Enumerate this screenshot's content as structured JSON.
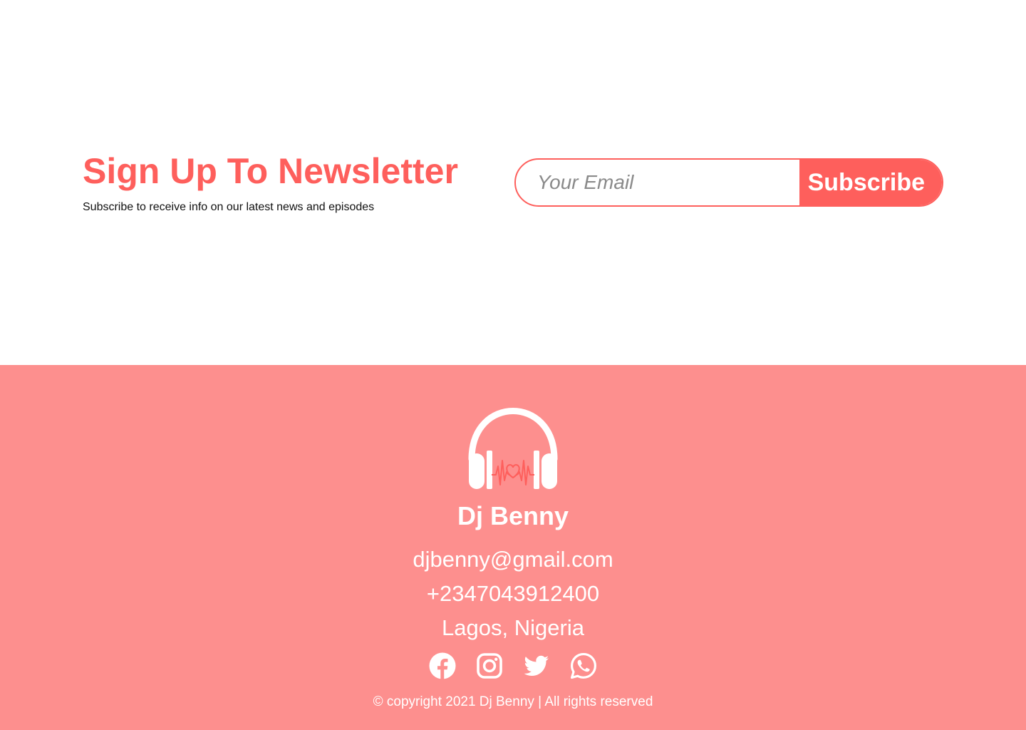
{
  "newsletter": {
    "title": "Sign Up To Newsletter",
    "subtitle": "Subscribe to receive info on our latest news and episodes",
    "email_placeholder": "Your Email",
    "email_value": "",
    "subscribe_label": "Subscribe"
  },
  "footer": {
    "logo_icon": "headphones-heartbeat-icon",
    "brand_name": "Dj Benny",
    "email": "djbenny@gmail.com",
    "phone": "+2347043912400",
    "location": "Lagos, Nigeria",
    "socials": [
      {
        "icon": "facebook-icon"
      },
      {
        "icon": "instagram-icon"
      },
      {
        "icon": "twitter-icon"
      },
      {
        "icon": "whatsapp-icon"
      }
    ],
    "copyright": "© copyright 2021 Dj Benny | All rights reserved"
  },
  "colors": {
    "accent": "#fe5f5c",
    "footer_background": "#fd8f8e",
    "text_on_footer": "#ffffff",
    "subtitle_text": "#111111"
  }
}
